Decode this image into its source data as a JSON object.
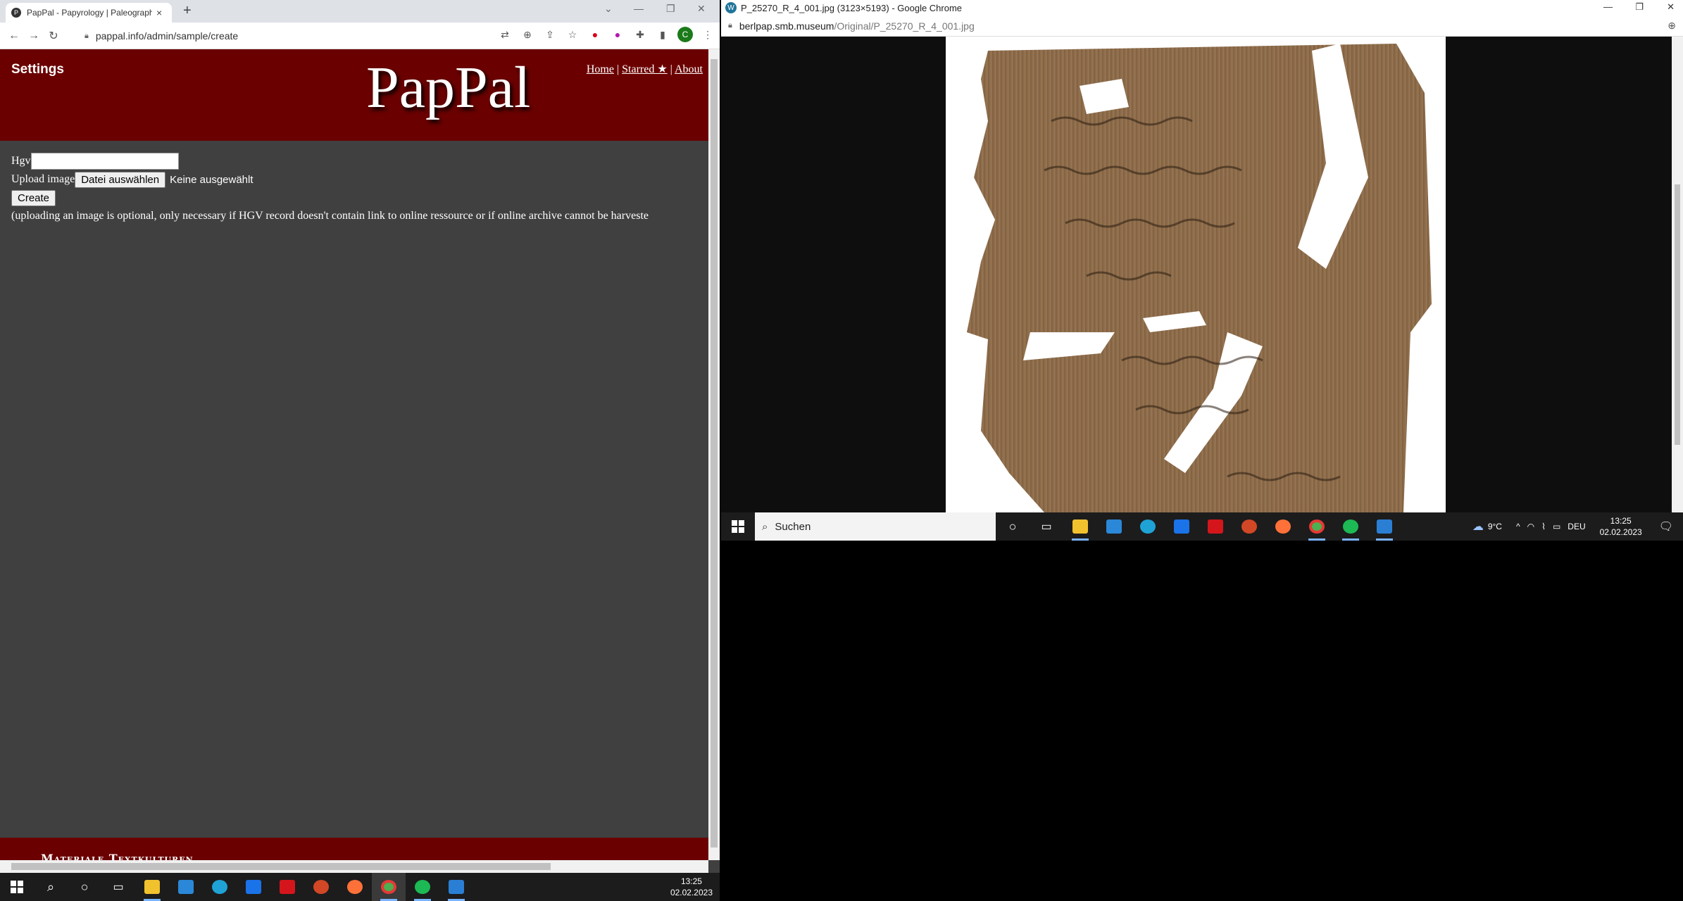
{
  "left_browser": {
    "tab_title": "PapPal - Papyrology | Paleograph",
    "tab_close": "×",
    "new_tab": "+",
    "favicon": "P",
    "window_controls": [
      "⌄",
      "—",
      "❐",
      "✕"
    ],
    "nav": {
      "back": "←",
      "forward": "→",
      "reload": "↻"
    },
    "url": "pappal.info/admin/sample/create",
    "profile_initial": "C",
    "toolbar_icons": [
      "translate-icon",
      "zoom-icon",
      "share-icon",
      "star-icon",
      "extension-red-icon",
      "extension-purple-icon",
      "puzzle-icon",
      "sidepanel-icon"
    ],
    "more": "⋮"
  },
  "page": {
    "settings_label": "Settings",
    "logo": "PapPal",
    "nav": {
      "home": "Home",
      "starred": "Starred ★",
      "about": "About",
      "separator": "|"
    },
    "form": {
      "hgv_label": "Hgv",
      "hgv_value": "",
      "upload_label": "Upload image",
      "choose_file_label": "Datei auswählen",
      "no_file_label": "Keine ausgewählt",
      "create_label": "Create",
      "note": "(uploading an image is optional, only necessary if HGV record doesn't contain link to online ressource or if online archive cannot be harveste"
    },
    "footer_text": "Materiale Textkulturen"
  },
  "right_browser": {
    "title": "P_25270_R_4_001.jpg (3123×5193) - Google Chrome",
    "favicon": "W",
    "window_controls": [
      "—",
      "❐",
      "✕"
    ],
    "url_host": "berlpap.smb.museum",
    "url_path": "/Original/P_25270_R_4_001.jpg",
    "zoom_icon": "⊕"
  },
  "taskbar_right": {
    "search_placeholder": "Suchen",
    "weather": "9°C",
    "language": "DEU",
    "time": "13:25",
    "date": "02.02.2023",
    "apps": [
      {
        "name": "task-view-icon",
        "color": "#ffffff"
      },
      {
        "name": "widgets-icon",
        "color": "#ffffff"
      },
      {
        "name": "file-explorer-icon",
        "color": "#f2c12e"
      },
      {
        "name": "ms-store-icon",
        "color": "#2b88d8"
      },
      {
        "name": "edge-icon",
        "color": "#1fa2d6"
      },
      {
        "name": "mail-icon",
        "color": "#1a73e8"
      },
      {
        "name": "acrobat-icon",
        "color": "#d4161c"
      },
      {
        "name": "powerpoint-icon",
        "color": "#d24726"
      },
      {
        "name": "firefox-icon",
        "color": "#ff7139"
      },
      {
        "name": "chrome-icon",
        "color": "#4caf50"
      },
      {
        "name": "spotify-icon",
        "color": "#1db954"
      },
      {
        "name": "photos-icon",
        "color": "#2a7fd4"
      }
    ]
  },
  "taskbar_bottom": {
    "time": "13:25",
    "date": "02.02.2023",
    "apps": [
      {
        "name": "file-explorer-icon",
        "color": "#f2c12e"
      },
      {
        "name": "ms-store-icon",
        "color": "#2b88d8"
      },
      {
        "name": "edge-icon",
        "color": "#1fa2d6"
      },
      {
        "name": "mail-icon",
        "color": "#1a73e8"
      },
      {
        "name": "acrobat-icon",
        "color": "#d4161c"
      },
      {
        "name": "powerpoint-icon",
        "color": "#d24726"
      },
      {
        "name": "firefox-icon",
        "color": "#ff7139"
      },
      {
        "name": "chrome-icon",
        "color": "#4caf50"
      },
      {
        "name": "spotify-icon",
        "color": "#1db954"
      },
      {
        "name": "photos-icon",
        "color": "#2a7fd4"
      }
    ]
  }
}
